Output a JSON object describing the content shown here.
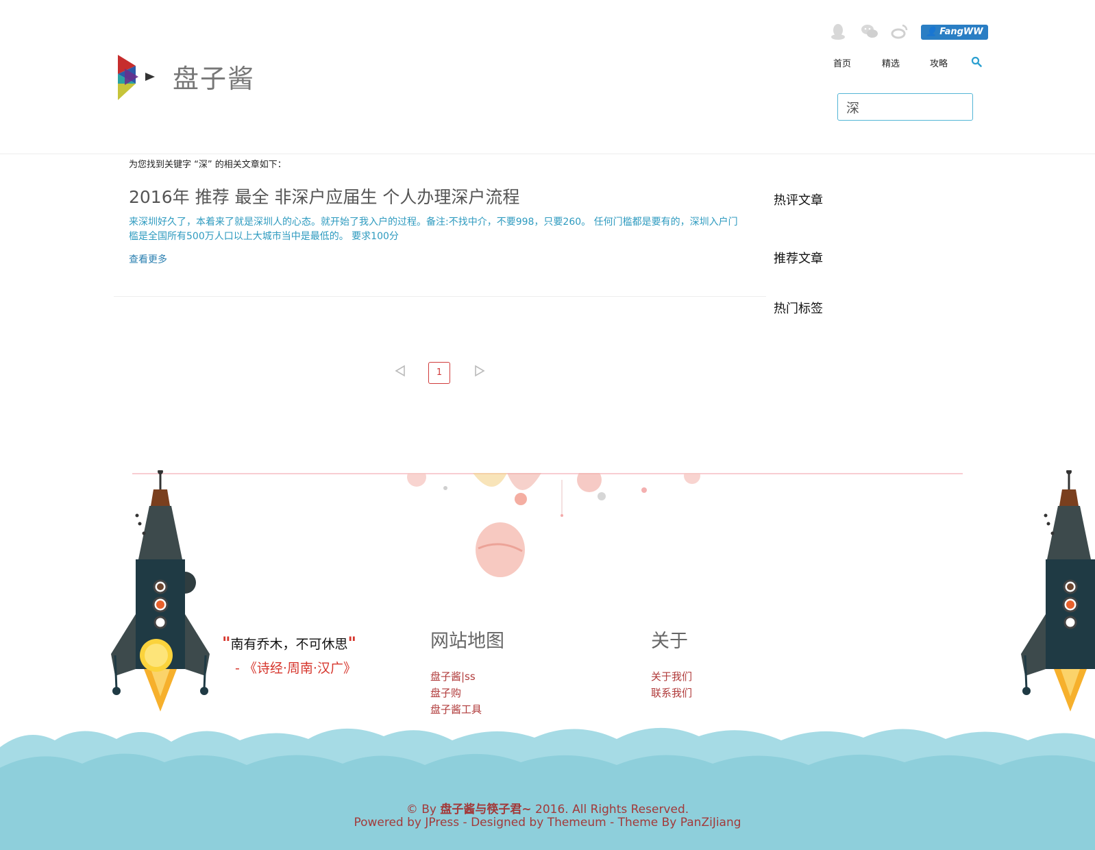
{
  "header": {
    "site_title": "盘子酱",
    "user_badge": "FangWW",
    "nav": [
      "首页",
      "精选",
      "攻略"
    ],
    "search_value": "深",
    "social_icons": [
      "qq-icon",
      "wechat-icon",
      "weibo-icon"
    ]
  },
  "content": {
    "result_note": "为您找到关键字 “深” 的相关文章如下：",
    "article": {
      "title": "2016年 推荐 最全 非深户应届生 个人办理深户流程",
      "excerpt": "来深圳好久了，本着来了就是深圳人的心态。就开始了我入户的过程。备注:不找中介，不要998，只要260。 任何门槛都是要有的，深圳入户门槛是全国所有500万人口以上大城市当中是最低的。 要求100分",
      "read_more": "查看更多"
    },
    "sidebar": [
      "热评文章",
      "推荐文章",
      "热门标签"
    ],
    "pagination": {
      "current": "1"
    }
  },
  "footer": {
    "quote": "南有乔木，不可休思",
    "quote_open": "\"",
    "quote_close": "\"",
    "quote_source": "- 《诗经·周南·汉广》",
    "sitemap_title": "网站地图",
    "sitemap_links": [
      "盘子酱|ss",
      "盘子购",
      "盘子酱工具"
    ],
    "about_title": "关于",
    "about_links": [
      "关于我们",
      "联系我们"
    ],
    "copyright_prefix": "© By",
    "copyright_name": "盘子酱与筷子君~",
    "copyright_suffix": "2016. All Rights Reserved.",
    "powered": "Powered by JPress - Designed by Themeum - Theme By PanZiJiang"
  },
  "colors": {
    "accent_blue": "#2a7ec4",
    "link_teal": "#2d9abf",
    "footer_red": "#a23a3a",
    "cloud": "#8ecfdb"
  }
}
